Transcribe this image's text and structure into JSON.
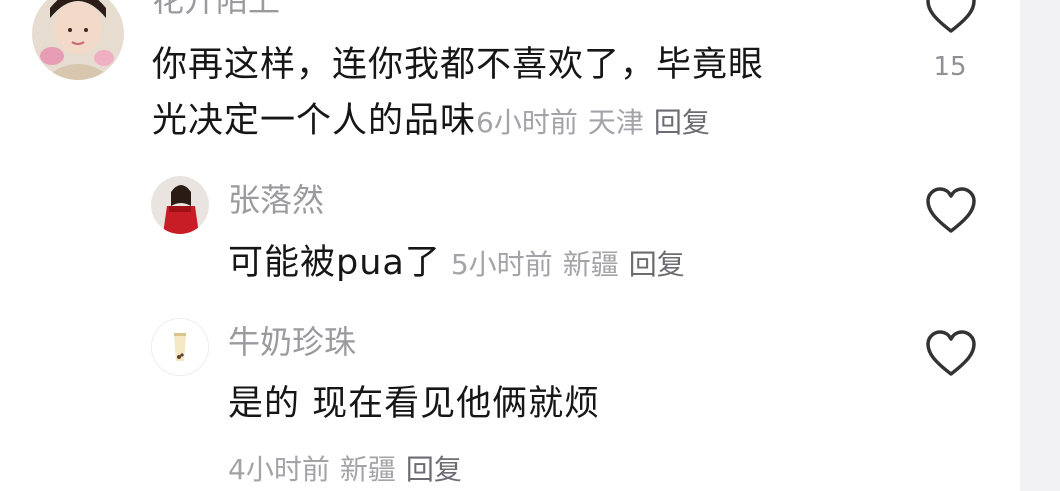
{
  "comments": [
    {
      "username": "花开陌上",
      "text_line1": "你再这样，连你我都不喜欢了，毕竟眼",
      "text_line2": "光决定一个人的品味",
      "time": "6小时前",
      "location": "天津",
      "reply": "回复",
      "likes": "15"
    },
    {
      "username": "张落然",
      "text": "可能被pua了",
      "time": "5小时前",
      "location": "新疆",
      "reply": "回复"
    },
    {
      "username": "牛奶珍珠",
      "text": "是的 现在看见他俩就烦",
      "time": "4小时前",
      "location": "新疆",
      "reply": "回复"
    }
  ],
  "icons": {
    "like": "heart-outline-icon"
  },
  "colors": {
    "username": "#9a9a9f",
    "text": "#161616",
    "meta": "#a3a3a8",
    "reply": "#6c6c72",
    "heart": "#333333"
  }
}
